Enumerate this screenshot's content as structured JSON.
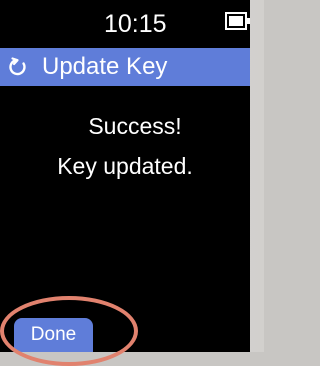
{
  "status_bar": {
    "time": "10:15",
    "battery_icon": "battery-icon"
  },
  "title_bar": {
    "icon": "refresh-icon",
    "title": "Update Key"
  },
  "message": {
    "line1": "Success!",
    "line2": "Key updated."
  },
  "actions": {
    "done_label": "Done"
  },
  "colors": {
    "accent": "#5f7dd9",
    "highlight": "#e1826e",
    "background": "#000000"
  }
}
